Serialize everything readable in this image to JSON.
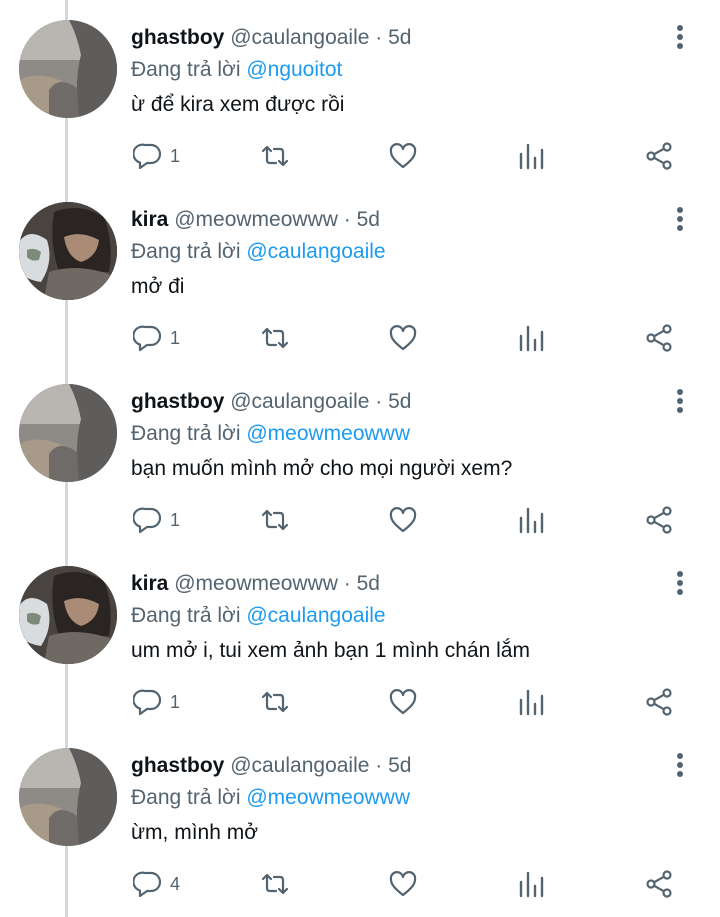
{
  "reply_prefix": "Đang trả lời",
  "tweets": [
    {
      "name": "ghastboy",
      "handle": "@caulangoaile",
      "time": "5d",
      "reply_to": "@nguoitot",
      "text": "ừ để kira xem được rồi",
      "replies": "1",
      "avatar": "ghastboy"
    },
    {
      "name": "kira",
      "handle": "@meowmeowww",
      "time": "5d",
      "reply_to": "@caulangoaile",
      "text": "mở đi",
      "replies": "1",
      "avatar": "kira"
    },
    {
      "name": "ghastboy",
      "handle": "@caulangoaile",
      "time": "5d",
      "reply_to": "@meowmeowww",
      "text": "bạn muốn mình mở cho mọi người xem?",
      "replies": "1",
      "avatar": "ghastboy"
    },
    {
      "name": "kira",
      "handle": "@meowmeowww",
      "time": "5d",
      "reply_to": "@caulangoaile",
      "text": "um mở i, tui xem ảnh bạn 1 mình chán lắm",
      "replies": "1",
      "avatar": "kira"
    },
    {
      "name": "ghastboy",
      "handle": "@caulangoaile",
      "time": "5d",
      "reply_to": "@meowmeowww",
      "text": "ừm, mình mở",
      "replies": "4",
      "avatar": "ghastboy"
    }
  ],
  "colors": {
    "text": "#0f1419",
    "secondary": "#536471",
    "mention": "#1d9bf0",
    "thread_line": "#cfd9de"
  },
  "icons": [
    "reply-icon",
    "retweet-icon",
    "like-icon",
    "views-icon",
    "share-icon",
    "more-icon"
  ]
}
